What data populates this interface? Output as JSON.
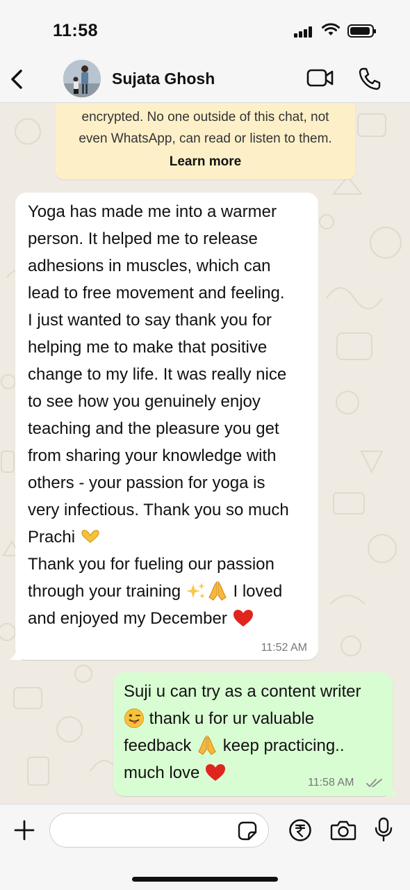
{
  "status_bar": {
    "time": "11:58"
  },
  "header": {
    "contact_name": "Sujata Ghosh"
  },
  "encryption_notice": {
    "line1": "encrypted. No one outside of this chat, not",
    "line2": "even WhatsApp, can read or listen to them.",
    "learn_more": "Learn more"
  },
  "messages": [
    {
      "direction": "incoming",
      "lines": [
        "Yoga has made me into a warmer",
        "person. It  helped me to release",
        "adhesions in muscles, which can",
        "lead to free movement and feeling.",
        "I  just wanted to say thank you for",
        "helping me to make that positive",
        "change to my life. It was really nice",
        "to see how you genuinely enjoy",
        "teaching and the pleasure you get",
        "from sharing your knowledge with",
        "others - your passion for yoga is",
        "very infectious. Thank you so much",
        "Prachi",
        "Thank you for fueling our passion",
        "through your training",
        "I loved",
        "and enjoyed my December"
      ],
      "time": "11:52 AM"
    },
    {
      "direction": "outgoing",
      "lines": [
        "Suji u can try as a content writer",
        "thank u for ur valuable",
        "feedback",
        "keep practicing..",
        "much love"
      ],
      "time": "11:58 AM",
      "status": "read"
    }
  ],
  "input": {
    "placeholder": ""
  },
  "colors": {
    "chat_bg": "#efeae2",
    "incoming_bubble": "#ffffff",
    "outgoing_bubble": "#d9fdd3",
    "notice_bg": "#fdf0c9",
    "read_ticks": "#8a8a8a"
  },
  "icons": [
    "back-icon",
    "video-call-icon",
    "phone-call-icon",
    "plus-icon",
    "sticker-icon",
    "rupee-payment-icon",
    "camera-icon",
    "microphone-icon",
    "heart-hands-emoji",
    "sparkles-emoji",
    "folded-hands-emoji",
    "red-heart-emoji",
    "tongue-wink-emoji",
    "double-check-icon"
  ]
}
